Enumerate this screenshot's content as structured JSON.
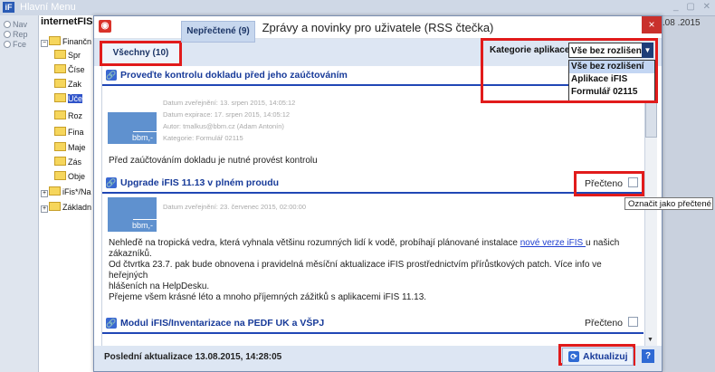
{
  "bg": {
    "window_title": "Hlavní Menu",
    "app_icon": "iF",
    "radios": [
      "Nav",
      "Rep",
      "Fce"
    ],
    "tree_title": "internetFIS",
    "tree": [
      "Finančn",
      "Spr",
      "Čísе",
      "Zak",
      "Úče",
      "Roz",
      "Fina",
      "Maje",
      "Zás",
      "Obje",
      "iFis*/Na",
      "Základn"
    ],
    "date": ".13.08 .2015"
  },
  "dialog": {
    "title": "Zprávy a novinky pro uživatele (RSS čtečka)",
    "close_glyph": "×"
  },
  "tabs": {
    "all": "Všechny (10)",
    "unread": "Nepřečtené (9)"
  },
  "category": {
    "label": "Kategorie aplikace",
    "selected": "Vše bez rozlišení",
    "options": [
      "Vše bez rozlišení",
      "Aplikace iFIS",
      "Formulář 02115"
    ]
  },
  "items": [
    {
      "title": "Proveďte kontrolu dokladu před jeho zaúčtováním",
      "thumb_text": "bbm,-",
      "meta": [
        "Datum zveřejnění: 13. srpen 2015, 14:05:12",
        "Datum expirace: 17. srpen 2015, 14:05:12",
        "Autor: tmalkus@bbm.cz (Adam Antonín)",
        "Kategorie: Formulář 02115"
      ],
      "body": "Před zaúčtováním dokladu je nutné provést kontrolu"
    },
    {
      "title": "Upgrade iFIS 11.13 v plném proudu",
      "read_label": "Přečteno",
      "thumb_text": "bbm,-",
      "meta": [
        "Datum zveřejnění: 23. červenec 2015, 02:00:00"
      ],
      "body1_a": "Nehleďě na tropická vedra, která vyhnala většinu rozumných lidí k vodě, probíhají plánované instalace ",
      "body1_link": "nové verze iFIS ",
      "body1_b": "u našich",
      "body1_c": "zákazníků.",
      "body2_a": "Od čtvrtka 23.7. pak bude obnovena i pravidelná měsíční aktualizace iFIS prostřednictvím přírůstkových patch. Více info ve heřejných",
      "body2_b": "hlášeních na HelpDesku.",
      "body3": "Přejeme všem krásné léto a mnoho příjemných zážitků s aplikacemi iFIS 11.13."
    },
    {
      "title": "Modul iFIS/Inventarizace na PEDF UK a VŠPJ",
      "read_label": "Přečteno"
    }
  ],
  "tooltip": "Označit jako přečtené",
  "footer": {
    "last_update": "Poslední aktualizace 13.08.2015, 14:28:05",
    "refresh_label": "Aktualizuj",
    "help_label": "?"
  },
  "colors": {
    "accent": "#2047b5",
    "highlight_red": "#e11b1b",
    "rss_red": "#d9332a",
    "title_blue": "#173a99"
  }
}
